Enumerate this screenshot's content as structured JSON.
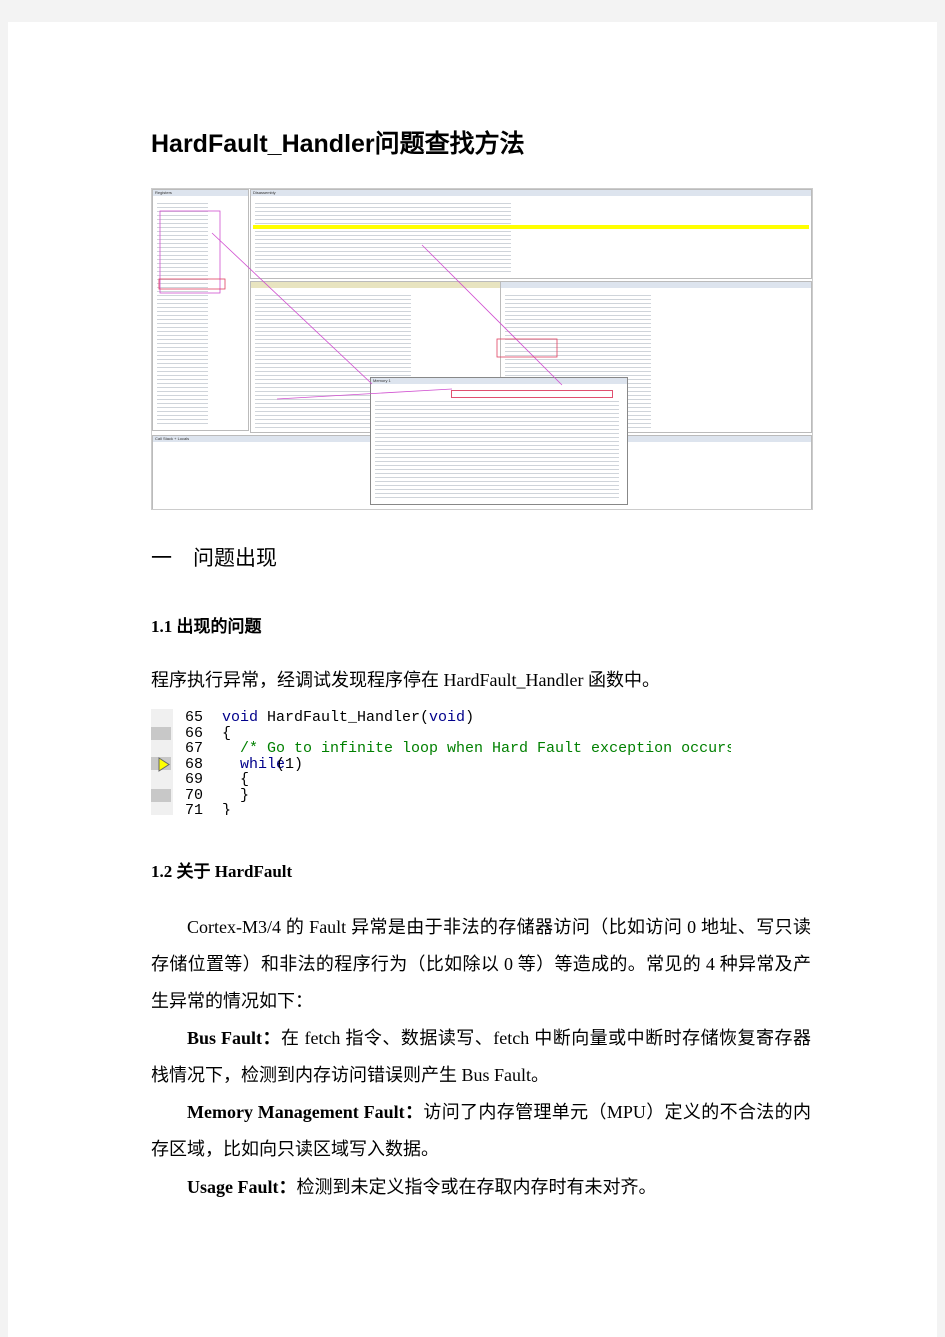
{
  "title": "HardFault_Handler问题查找方法",
  "figure": {
    "panels": {
      "registers": "Registers",
      "disassembly": "Disassembly",
      "memory": "Memory 1",
      "callstack": "Call Stack + Locals"
    }
  },
  "section1": {
    "heading": "一　问题出现"
  },
  "s1_1": {
    "heading": "1.1  出现的问题",
    "text": "程序执行异常，经调试发现程序停在 HardFault_Handler 函数中。"
  },
  "code": {
    "lines": [
      {
        "n": "65",
        "pre": "",
        "kw": "void",
        "rest": " HardFault_Handler(",
        "kw2": "void",
        "post": ")"
      },
      {
        "n": "66",
        "text": "{"
      },
      {
        "n": "67",
        "comment": "  /* Go to infinite loop when Hard Fault exception occurs */"
      },
      {
        "n": "68",
        "kw": "  while",
        "rest": " (1)"
      },
      {
        "n": "69",
        "text": "  {"
      },
      {
        "n": "70",
        "text": "  }"
      },
      {
        "n": "71",
        "text": "}"
      }
    ]
  },
  "s1_2": {
    "heading": "1.2  关于 HardFault",
    "intro": "Cortex-M3/4 的 Fault 异常是由于非法的存储器访问（比如访问 0 地址、写只读存储位置等）和非法的程序行为（比如除以 0 等）等造成的。常见的 4 种异常及产生异常的情况如下：",
    "items": [
      {
        "term": "Bus Fault：",
        "desc": "在 fetch 指令、数据读写、fetch 中断向量或中断时存储恢复寄存器栈情况下，检测到内存访问错误则产生 Bus Fault。"
      },
      {
        "term": "Memory Management Fault：",
        "desc": "访问了内存管理单元（MPU）定义的不合法的内存区域，比如向只读区域写入数据。"
      },
      {
        "term": "Usage Fault：",
        "desc": "检测到未定义指令或在存取内存时有未对齐。"
      }
    ]
  }
}
